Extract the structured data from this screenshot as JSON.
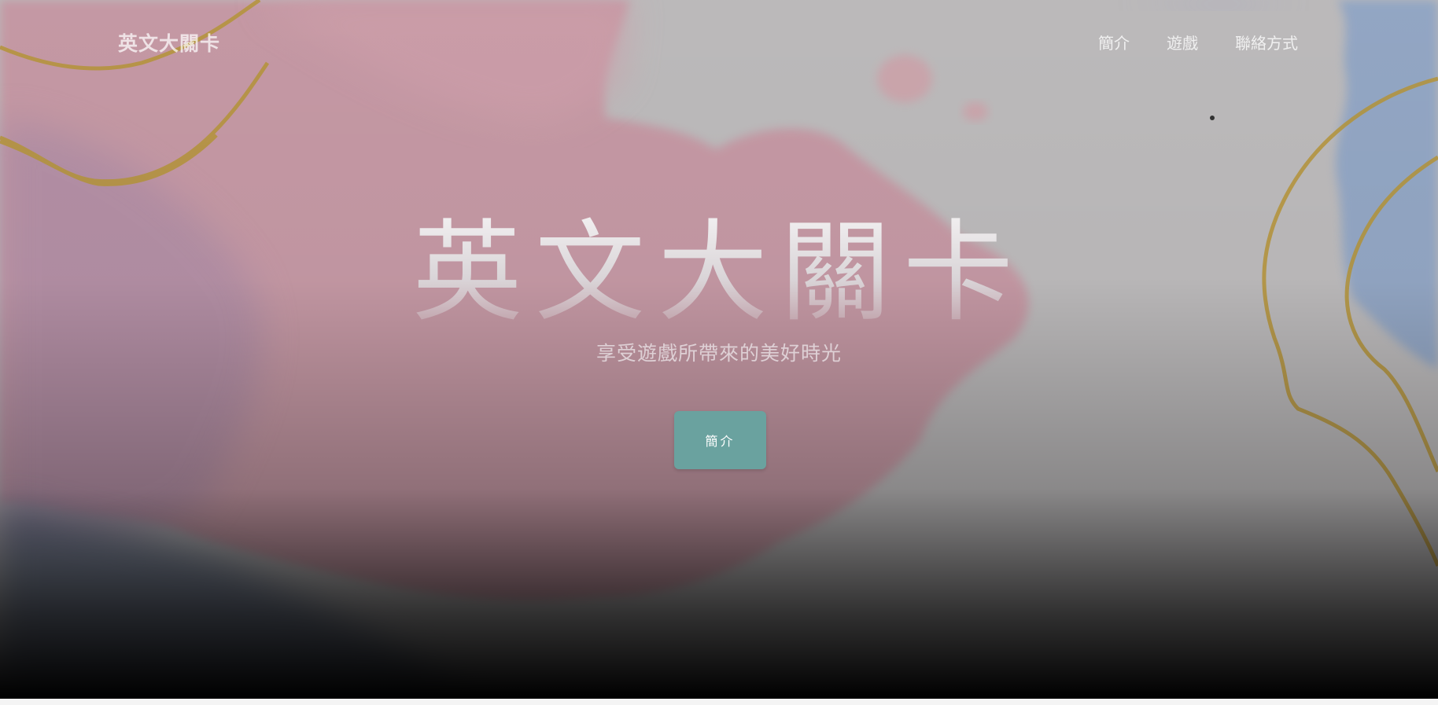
{
  "site": {
    "brand": "英文大關卡"
  },
  "nav": {
    "items": [
      {
        "label": "簡介"
      },
      {
        "label": "遊戲"
      },
      {
        "label": "聯絡方式"
      }
    ]
  },
  "hero": {
    "title": "英文大關卡",
    "subtitle": "享受遊戲所帶來的美好時光",
    "button_label": "簡介"
  },
  "colors": {
    "button": "#6aa29f",
    "pink_wash": "#c98f9f",
    "blue_wash": "#8ea6c9",
    "gold_line": "#b8973a"
  }
}
